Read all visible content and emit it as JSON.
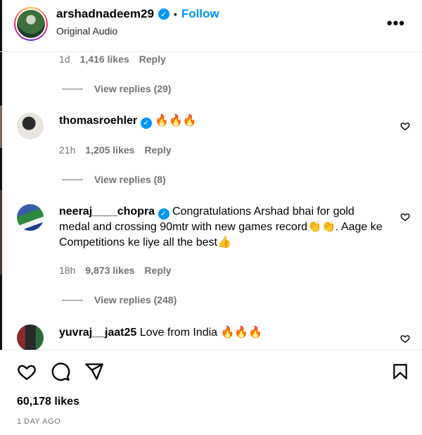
{
  "post": {
    "username": "arshadnadeem29",
    "separator": "•",
    "follow_label": "Follow",
    "audio": "Original Audio",
    "more_label": "•••"
  },
  "comments": [
    {
      "meta": {
        "age": "1d",
        "likes": "1,416 likes",
        "reply": "Reply"
      },
      "view_replies": "View replies (29)"
    },
    {
      "username": "thomasroehler",
      "text": "🔥🔥🔥",
      "meta": {
        "age": "21h",
        "likes": "1,205 likes",
        "reply": "Reply"
      },
      "view_replies": "View replies (8)"
    },
    {
      "username": "neeraj____chopra",
      "text": "Congratulations Arshad bhai for gold medal and crossing 90mtr with new games record👏👏. Aage ke Competitions ke liye all the best👍",
      "meta": {
        "age": "18h",
        "likes": "9,873 likes",
        "reply": "Reply"
      },
      "view_replies": "View replies (248)"
    },
    {
      "username": "yuvraj__jaat25",
      "text": "Love from India 🔥🔥🔥"
    }
  ],
  "footer": {
    "likes": "60,178 likes",
    "date": "1 DAY AGO"
  },
  "icons": [
    "heart-icon",
    "comment-icon",
    "share-icon",
    "bookmark-icon",
    "verified-icon",
    "more-icon"
  ],
  "colors": {
    "accent": "#0095f6",
    "muted": "#737373"
  }
}
